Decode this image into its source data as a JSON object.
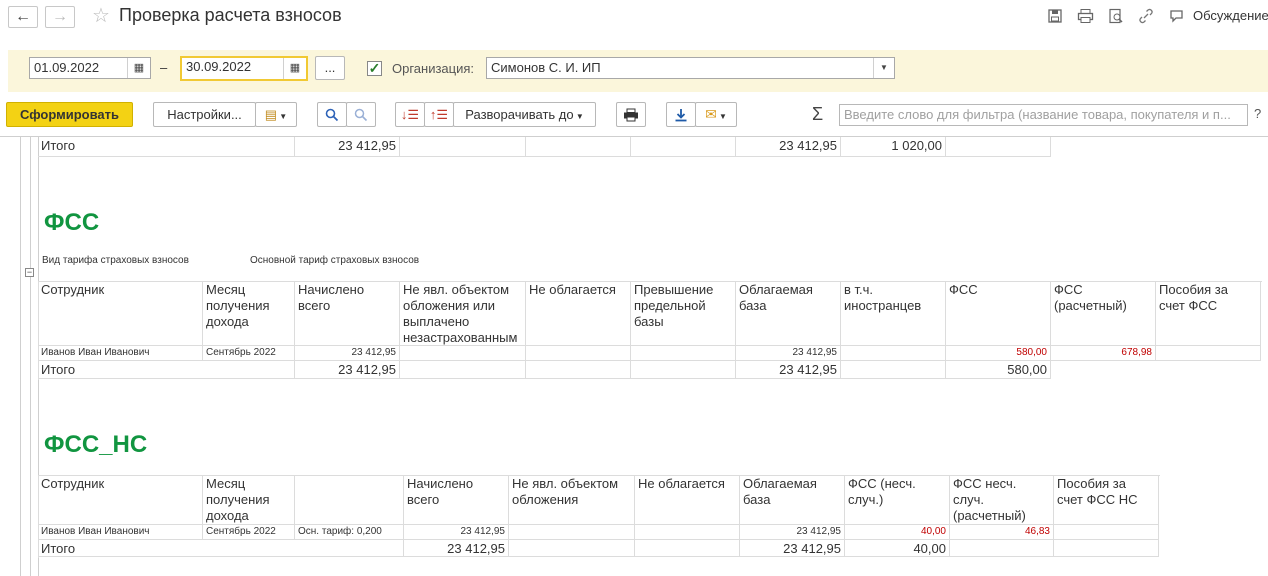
{
  "header": {
    "title": "Проверка расчета взносов",
    "back_icon": "←",
    "forward_icon": "→",
    "discussion_label": "Обсуждение"
  },
  "params": {
    "date_from": "01.09.2022",
    "dash": "–",
    "date_to": "30.09.2022",
    "period_button": "...",
    "org_checked": true,
    "org_label": "Организация:",
    "org_value": "Симонов С. И. ИП"
  },
  "toolbar": {
    "generate": "Сформировать",
    "settings": "Настройки...",
    "expand_to": "Разворачивать до",
    "sigma": "Σ",
    "search_placeholder": "Введите слово для фильтра (название товара, покупателя и п...",
    "help": "?"
  },
  "prev_total": {
    "label": "Итого",
    "accrued": "23 412,95",
    "taxable": "23 412,95",
    "foreigners": "1 020,00"
  },
  "fss": {
    "title": "ФСС",
    "tariff_label": "Вид тарифа страховых взносов",
    "tariff_value": "Основной тариф страховых взносов",
    "headers": [
      "Сотрудник",
      "Месяц получения дохода",
      "Начислено всего",
      "Не явл. объектом обложения или выплачено незастрахованным",
      "Не облагается",
      "Превышение предельной базы",
      "Облагаемая база",
      "в т.ч. иностранцев",
      "ФСС",
      "ФСС (расчетный)",
      "Пособия за счет ФСС"
    ],
    "row": {
      "employee": "Иванов Иван Иванович",
      "month": "Сентябрь 2022",
      "accrued": "23 412,95",
      "taxable": "23 412,95",
      "fss": "580,00",
      "fss_calc": "678,98"
    },
    "total": {
      "label": "Итого",
      "accrued": "23 412,95",
      "taxable": "23 412,95",
      "fss": "580,00"
    }
  },
  "fss_ns": {
    "title": "ФСС_НС",
    "headers": [
      "Сотрудник",
      "Месяц получения дохода",
      "",
      "Начислено всего",
      "Не явл. объектом обложения",
      "Не облагается",
      "Облагаемая база",
      "ФСС (несч. случ.)",
      "ФСС несч. случ. (расчетный)",
      "Пособия за счет ФСС НС"
    ],
    "row": {
      "employee": "Иванов Иван Иванович",
      "month": "Сентябрь 2022",
      "tariff": "Осн. тариф: 0,200",
      "accrued": "23 412,95",
      "taxable": "23 412,95",
      "fss_ns": "40,00",
      "fss_ns_calc": "46,83"
    },
    "total": {
      "label": "Итого",
      "accrued": "23 412,95",
      "taxable": "23 412,95",
      "fss_ns": "40,00"
    }
  },
  "colors": {
    "section_title": "#119540",
    "primary_button": "#f3d214",
    "params_bg": "#fbf6db",
    "computed_value": "#c00000"
  }
}
